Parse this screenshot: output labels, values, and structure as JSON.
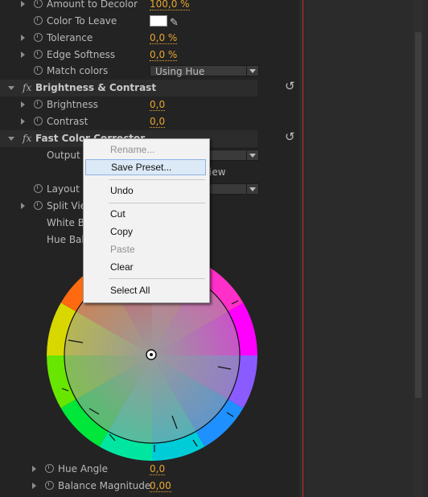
{
  "effect_controls": {
    "amount_to_decolor": {
      "label": "Amount to Decolor",
      "value": "100,0 %"
    },
    "color_to_leave": {
      "label": "Color To Leave",
      "swatch_color": "#ffffff",
      "eyedropper_icon": "eyedropper-icon"
    },
    "tolerance": {
      "label": "Tolerance",
      "value": "0,0 %"
    },
    "edge_softness": {
      "label": "Edge Softness",
      "value": "0,0 %"
    },
    "match_colors": {
      "label": "Match colors",
      "value": "Using Hue"
    },
    "brightness_contrast": {
      "fx": "fx",
      "title": "Brightness & Contrast",
      "reset_icon": "reset-icon"
    },
    "brightness": {
      "label": "Brightness",
      "value": "0,0"
    },
    "contrast": {
      "label": "Contrast",
      "value": "0,0"
    },
    "fast_color": {
      "fx": "fx",
      "title": "Fast Color Corrector",
      "reset_icon": "reset-icon"
    },
    "output": {
      "label": "Output",
      "show_split_view_partial": "iew"
    },
    "layout": {
      "label": "Layout"
    },
    "split_view": {
      "label": "Split View"
    },
    "white_balance": {
      "label": "White Ba"
    },
    "hue_balance": {
      "label": "Hue Bala"
    },
    "hue_angle": {
      "label": "Hue Angle",
      "value": "0,0"
    },
    "balance_magnitude": {
      "label": "Balance Magnitude",
      "value": "0,00"
    }
  },
  "context_menu": {
    "rename": "Rename...",
    "save_preset": "Save Preset...",
    "undo": "Undo",
    "cut": "Cut",
    "copy": "Copy",
    "paste": "Paste",
    "clear": "Clear",
    "select_all": "Select All"
  },
  "colors": {
    "value_accent": "#e9a631",
    "playhead": "#d32a2a",
    "panel_bg": "#232323"
  }
}
